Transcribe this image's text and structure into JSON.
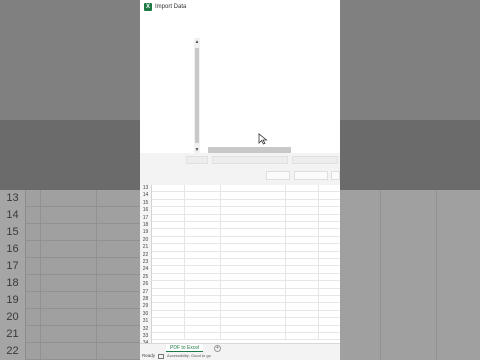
{
  "dialog": {
    "title": "Import Data"
  },
  "sheet": {
    "rows": [
      "13",
      "14",
      "15",
      "16",
      "17",
      "18",
      "19",
      "20",
      "21",
      "22",
      "23",
      "24",
      "25",
      "26",
      "27",
      "28",
      "29",
      "30",
      "31",
      "32",
      "33",
      "34"
    ]
  },
  "background_rows": [
    "13",
    "14",
    "15",
    "16",
    "17",
    "18",
    "19",
    "20",
    "21",
    "22"
  ],
  "tabs": {
    "active": "PDF to Excel",
    "add": "+"
  },
  "status": {
    "ready": "Ready",
    "accessibility": "Accessibility: Good to go"
  }
}
